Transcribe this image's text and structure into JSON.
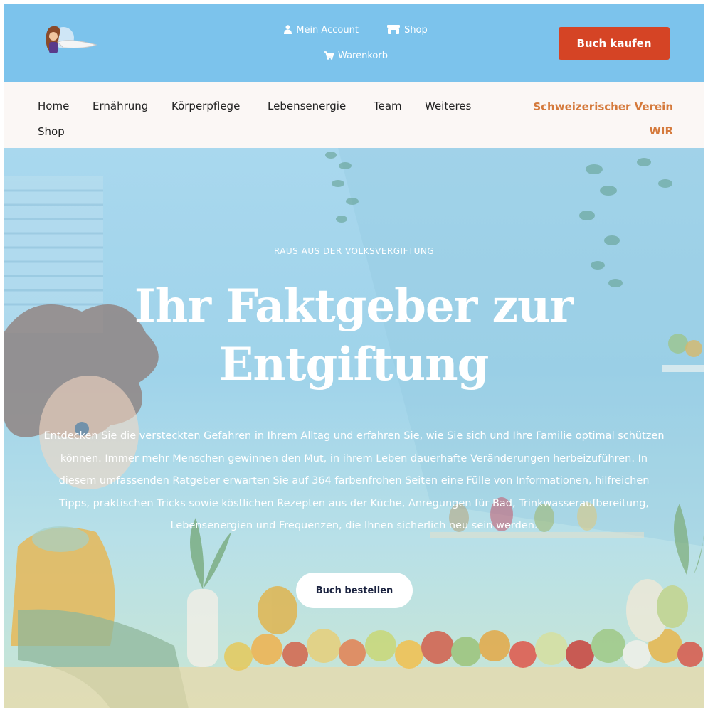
{
  "header": {
    "links_row1": [
      {
        "label": "Mein Account",
        "icon": "user-icon"
      },
      {
        "label": "Shop",
        "icon": "store-icon"
      }
    ],
    "links_row2": [
      {
        "label": "Warenkorb",
        "icon": "cart-icon"
      }
    ],
    "buy_button": "Buch kaufen",
    "colors": {
      "bar": "#7cc3ec",
      "buy_button": "#d54425"
    }
  },
  "nav": {
    "items": [
      "Home",
      "Ernährung",
      "Körperpflege",
      "Lebensenergie",
      "Team",
      "Weiteres",
      "Shop"
    ],
    "right_line1": "Schweizerischer Verein",
    "right_line2": "WIR",
    "colors": {
      "background": "#fbf7f5",
      "right_text": "#d57a3c"
    }
  },
  "hero": {
    "eyebrow": "RAUS AUS DER VOLKSVERGIFTUNG",
    "headline_line1": "Ihr Faktgeber zur",
    "headline_line2": "Entgiftung",
    "description": "Entdecken Sie die versteckten Gefahren in Ihrem Alltag und erfahren Sie, wie Sie sich und Ihre Familie optimal schützen können. Immer mehr Menschen gewinnen den Mut, in ihrem Leben dauerhafte Veränderungen herbeizuführen. In diesem umfassenden Ratgeber erwarten Sie auf 364 farbenfrohen Seiten eine Fülle von Informationen, hilfreichen Tipps, praktischen Tricks sowie köstlichen Rezepten aus der Küche, Anregungen für Bad, Trinkwasseraufbereitung, Lebensenergien und Frequenzen, die Ihnen sicherlich neu sein werden.",
    "cta": "Buch bestellen"
  }
}
